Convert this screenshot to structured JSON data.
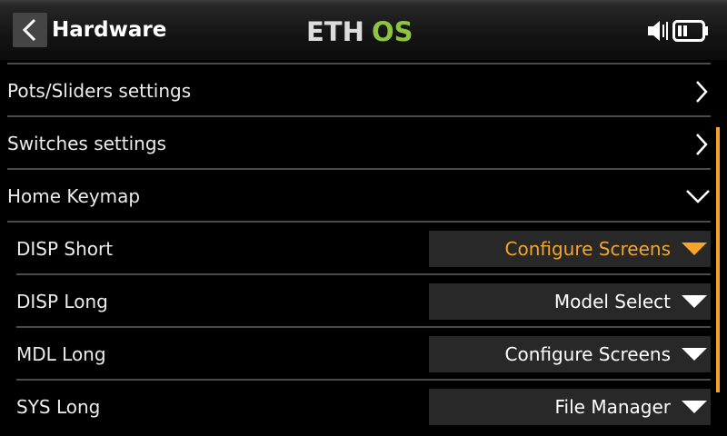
{
  "header": {
    "title": "Hardware",
    "logo_text_left": "ETH",
    "logo_text_right": "OS",
    "back_icon": "chevron-left-icon",
    "volume_icon": "speaker-icon",
    "battery_icon": "battery-icon"
  },
  "menu": [
    {
      "label": "Pots/Sliders settings",
      "icon": "chevron-right-icon"
    },
    {
      "label": "Switches settings",
      "icon": "chevron-right-icon"
    },
    {
      "label": "Home Keymap",
      "icon": "chevron-down-icon"
    }
  ],
  "keymap": [
    {
      "label": "DISP Short",
      "value": "Configure Screens",
      "active": true
    },
    {
      "label": "DISP Long",
      "value": "Model Select",
      "active": false
    },
    {
      "label": "MDL Long",
      "value": "Configure Screens",
      "active": false
    },
    {
      "label": "SYS Long",
      "value": "File Manager",
      "active": false
    }
  ],
  "colors": {
    "accent": "#f5a42a",
    "logo_green": "#8cc63f",
    "background": "#000000",
    "select_bg": "#282828"
  }
}
